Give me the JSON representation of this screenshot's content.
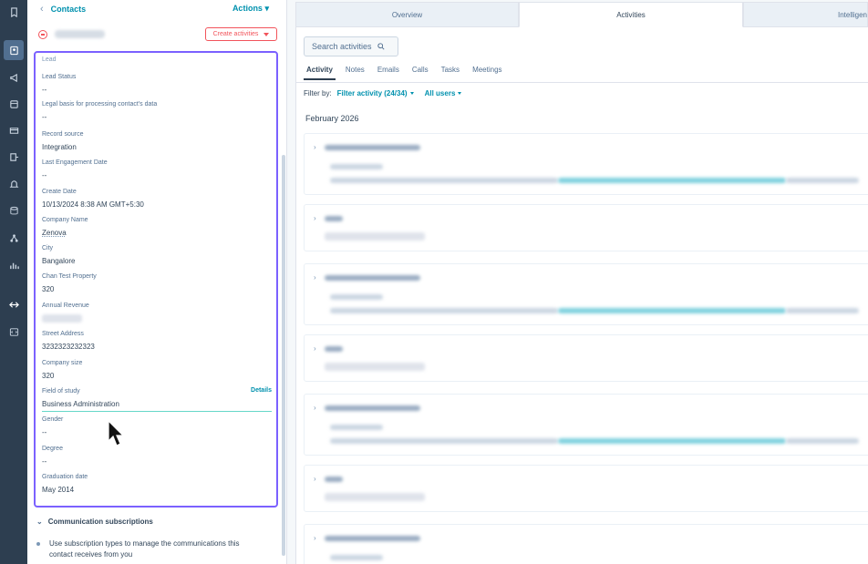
{
  "nav_rail": {
    "icons": [
      "bookmark-icon",
      "contacts-icon",
      "megaphone-icon",
      "calendar-icon",
      "inbox-icon",
      "export-icon",
      "bell-icon",
      "database-icon",
      "network-icon",
      "bar-chart-icon",
      "arrows-icon",
      "code-icon"
    ]
  },
  "sidebar": {
    "back_label": "Contacts",
    "actions_label": "Actions",
    "create_activities_label": "Create activities",
    "top_faded_label": "Lead",
    "properties": [
      {
        "label": "Lead Status",
        "value": "--"
      },
      {
        "label": "Legal basis for processing contact's data",
        "value": "--"
      },
      {
        "label": "Record source",
        "value": "Integration"
      },
      {
        "label": "Last Engagement Date",
        "value": "--"
      },
      {
        "label": "Create Date",
        "value": "10/13/2024 8:38 AM GMT+5:30"
      },
      {
        "label": "Company Name",
        "value": "Zenova"
      },
      {
        "label": "City",
        "value": "Bangalore"
      },
      {
        "label": "Chan Test Property",
        "value": "320"
      },
      {
        "label": "Annual Revenue",
        "value": ""
      },
      {
        "label": "Street Address",
        "value": "3232323232323"
      },
      {
        "label": "Company size",
        "value": "320"
      },
      {
        "label": "Field of study",
        "value": "Business Administration"
      },
      {
        "label": "Gender",
        "value": "--"
      },
      {
        "label": "Degree",
        "value": "--"
      },
      {
        "label": "Graduation date",
        "value": "May 2014"
      }
    ],
    "details_link": "Details",
    "comm_title": "Communication subscriptions",
    "comm_text_line1": "Use subscription types to manage the communications this",
    "comm_text_line2": "contact receives from you"
  },
  "main": {
    "tabs": [
      {
        "label": "Overview"
      },
      {
        "label": "Activities"
      },
      {
        "label": "Intelligen"
      }
    ],
    "search_placeholder": "Search activities",
    "subtabs": [
      {
        "label": "Activity"
      },
      {
        "label": "Notes"
      },
      {
        "label": "Emails"
      },
      {
        "label": "Calls"
      },
      {
        "label": "Tasks"
      },
      {
        "label": "Meetings"
      }
    ],
    "filter_by_label": "Filter by:",
    "filter_activity": "Filter activity (24/34)",
    "all_users": "All users",
    "month": "February 2026"
  },
  "colors": {
    "accent_link": "#0091ae",
    "highlight_box": "#7b61ff",
    "create_button": "#f2545b",
    "nav_rail_bg": "#2d3e50"
  }
}
